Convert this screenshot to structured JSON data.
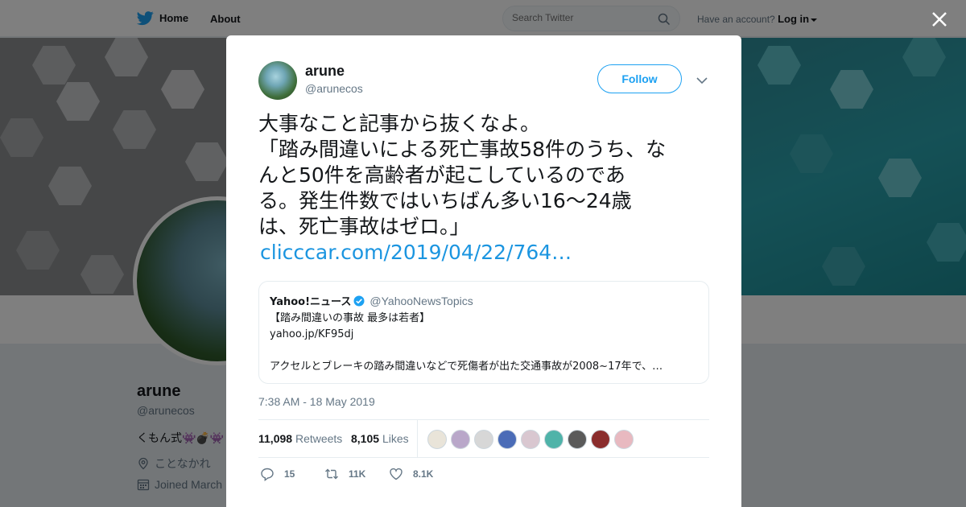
{
  "nav": {
    "home_label": "Home",
    "about_label": "About",
    "search_placeholder": "Search Twitter",
    "account_prompt": "Have an account?",
    "login_label": "Log in"
  },
  "profile": {
    "name": "arune",
    "handle": "@arunecos",
    "bio": "くもん式👾💣👾",
    "location": "ことなかれ",
    "joined": "Joined March"
  },
  "tweet": {
    "name": "arune",
    "handle": "@arunecos",
    "follow_label": "Follow",
    "text_lines": [
      "大事なこと記事から抜くなよ。",
      "「踏み間違いによる死亡事故58件のうち、な",
      "んと50件を高齢者が起こしているのであ",
      "る。発生件数ではいちばん多い16～24歳",
      "は、死亡事故はゼロ。」"
    ],
    "link": "clicccar.com/2019/04/22/764…",
    "timestamp": "7:38 AM - 18 May 2019",
    "retweets_count": "11,098",
    "retweets_label": "Retweets",
    "likes_count": "8,105",
    "likes_label": "Likes",
    "reply_count": "15",
    "retweet_action_count": "11K",
    "like_action_count": "8.1K"
  },
  "quote": {
    "name": "Yahoo!ニュース",
    "handle": "@YahooNewsTopics",
    "line1": "【踏み間違いの事故 最多は若者】",
    "line2": "yahoo.jp/KF95dj",
    "line3": "アクセルとブレーキの踏み間違いなどで死傷者が出た交通事故が2008~17年で、…"
  },
  "likers": [
    {
      "color": "#e9e4d9"
    },
    {
      "color": "#b9a7c9"
    },
    {
      "color": "#d7d7d7"
    },
    {
      "color": "#4b6cb7"
    },
    {
      "color": "#d9c7d0"
    },
    {
      "color": "#4fb3a9"
    },
    {
      "color": "#5a5a5a"
    },
    {
      "color": "#8b2d2d"
    },
    {
      "color": "#e8b9c0"
    }
  ],
  "colors": {
    "accent": "#1da1f2",
    "link": "#1b95e0",
    "banner_teal": "#2aa2ad"
  },
  "icons": {
    "logo": "twitter-bird-icon",
    "search": "search-icon",
    "close": "close-icon",
    "reply": "reply-icon",
    "retweet": "retweet-icon",
    "like": "heart-icon",
    "verified": "verified-badge-icon",
    "location": "location-pin-icon",
    "calendar": "calendar-icon"
  }
}
